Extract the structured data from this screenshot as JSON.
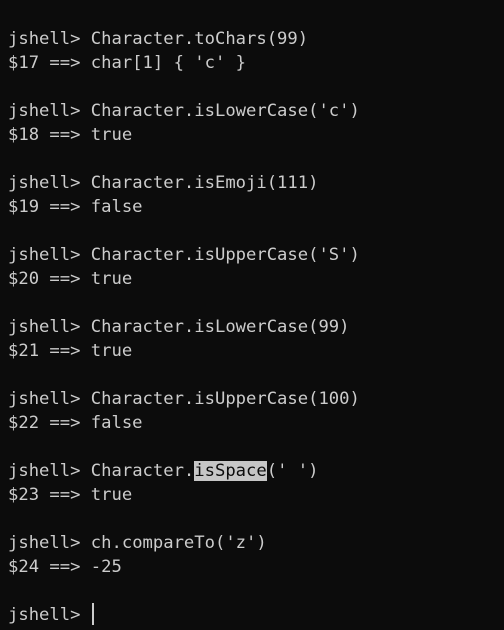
{
  "prompt": "jshell> ",
  "entries": [
    {
      "cmd": "Character.toChars(99)",
      "result": "$17 ==> char[1] { 'c' }"
    },
    {
      "cmd": "Character.isLowerCase('c')",
      "result": "$18 ==> true"
    },
    {
      "cmd": "Character.isEmoji(111)",
      "result": "$19 ==> false"
    },
    {
      "cmd": "Character.isUpperCase('S')",
      "result": "$20 ==> true"
    },
    {
      "cmd": "Character.isLowerCase(99)",
      "result": "$21 ==> true"
    },
    {
      "cmd": "Character.isUpperCase(100)",
      "result": "$22 ==> false"
    },
    {
      "cmd_pre": "Character.",
      "cmd_highlight": "isSpace",
      "cmd_post": "(' ')",
      "result": "$23 ==> true"
    },
    {
      "cmd": "ch.compareTo('z')",
      "result": "$24 ==> -25"
    }
  ],
  "current_input": ""
}
